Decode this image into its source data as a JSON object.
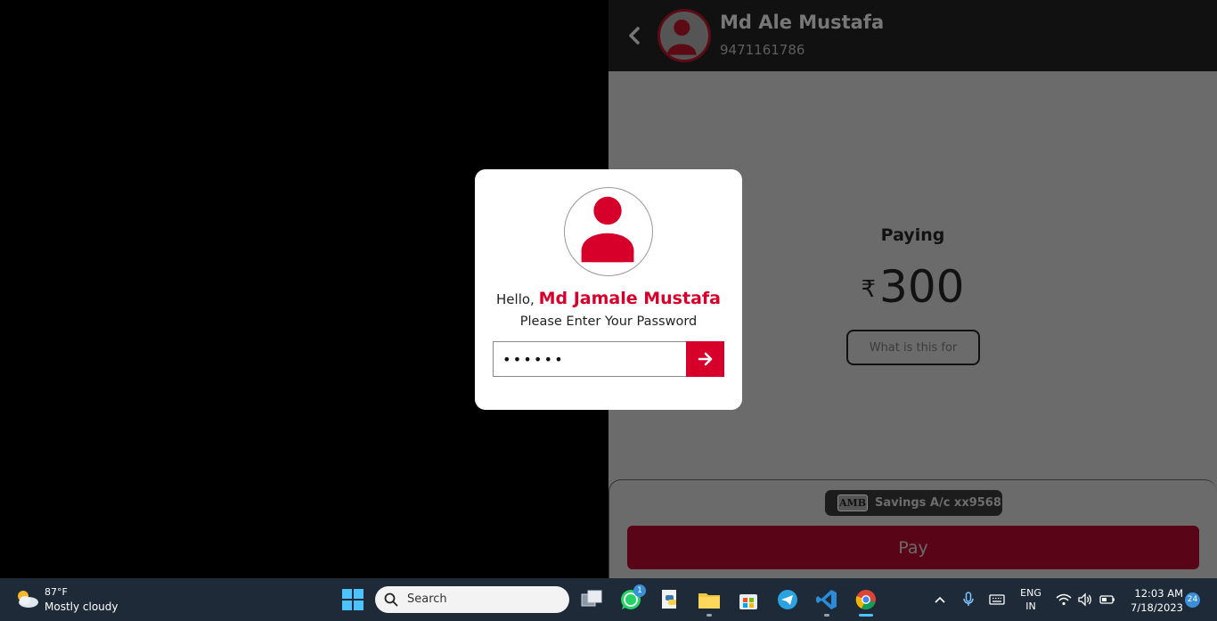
{
  "header": {
    "contact_name": "Md Ale Mustafa",
    "contact_phone": "9471161786"
  },
  "payment": {
    "paying_label": "Paying",
    "currency_symbol": "₹",
    "amount": "300",
    "purpose_button": "What is this for"
  },
  "account": {
    "bank_logo_text": "AMB",
    "account_label": "Savings A/c xx9568"
  },
  "pay_button": "Pay",
  "modal": {
    "hello_prefix": "Hello,",
    "user_name": "Md Jamale Mustafa",
    "prompt": "Please Enter Your Password",
    "password_value": "••••••"
  },
  "taskbar": {
    "weather_temp": "87°F",
    "weather_condition": "Mostly cloudy",
    "search_label": "Search",
    "whatsapp_badge": "1",
    "lang_line1": "ENG",
    "lang_line2": "IN",
    "time": "12:03 AM",
    "date": "7/18/2023",
    "notification_count": "24"
  },
  "colors": {
    "accent_red": "#d6002a",
    "dim_pay_red": "#5a0417",
    "taskbar_bg": "#1e2a38"
  }
}
